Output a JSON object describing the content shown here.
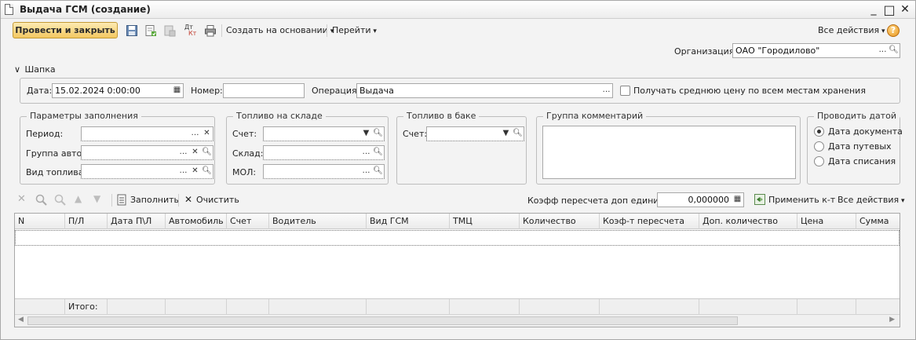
{
  "window": {
    "title": "Выдача ГСМ (создание)",
    "controls": {
      "minimize": "_",
      "maximize": "□",
      "close": "✕"
    }
  },
  "toolbar": {
    "post_close_label": "Провести и закрыть",
    "create_based_on_label": "Создать на основании",
    "goto_label": "Перейти",
    "all_actions_label": "Все действия",
    "help_label": "?",
    "dtkt_label_dt": "Дт",
    "dtkt_label_kt": "Кт"
  },
  "organization": {
    "label": "Организация:",
    "value": "ОАО \"Городилово\""
  },
  "header_section": {
    "toggle_label": "Шапка"
  },
  "header": {
    "date_label": "Дата:",
    "date_value": "15.02.2024  0:00:00",
    "number_label": "Номер:",
    "number_value": "",
    "operation_label": "Операция:",
    "operation_value": "Выдача",
    "avg_price_label": "Получать среднюю цену по всем местам хранения"
  },
  "fill_params": {
    "title": "Параметры заполнения",
    "period_label": "Период:",
    "auto_group_label": "Группа авто:",
    "fuel_type_label": "Вид топлива:"
  },
  "fuel_stock": {
    "title": "Топливо на складе",
    "account_label": "Счет:",
    "warehouse_label": "Склад:",
    "mol_label": "МОЛ:"
  },
  "fuel_tank": {
    "title": "Топливо в баке",
    "account_label": "Счет:"
  },
  "comments": {
    "title": "Группа комментарий"
  },
  "post_by_date": {
    "title": "Проводить датой",
    "options": [
      "Дата документа",
      "Дата путевых",
      "Дата списания"
    ],
    "selected": 0
  },
  "table_toolbar": {
    "fill_label": "Заполнить",
    "clear_label": "Очистить",
    "coef_label": "Коэфф пересчета доп единицы:",
    "coef_value": "0,000000",
    "apply_label": "Применить к-т",
    "all_actions_label": "Все действия"
  },
  "table": {
    "columns": [
      "N",
      "П/Л",
      "Дата П\\Л",
      "Автомобиль",
      "Счет",
      "Водитель",
      "Вид ГСМ",
      "ТМЦ",
      "Количество",
      "Коэф-т пересчета",
      "Доп. количество",
      "Цена",
      "Сумма"
    ],
    "footer_total_label": "Итого:"
  }
}
